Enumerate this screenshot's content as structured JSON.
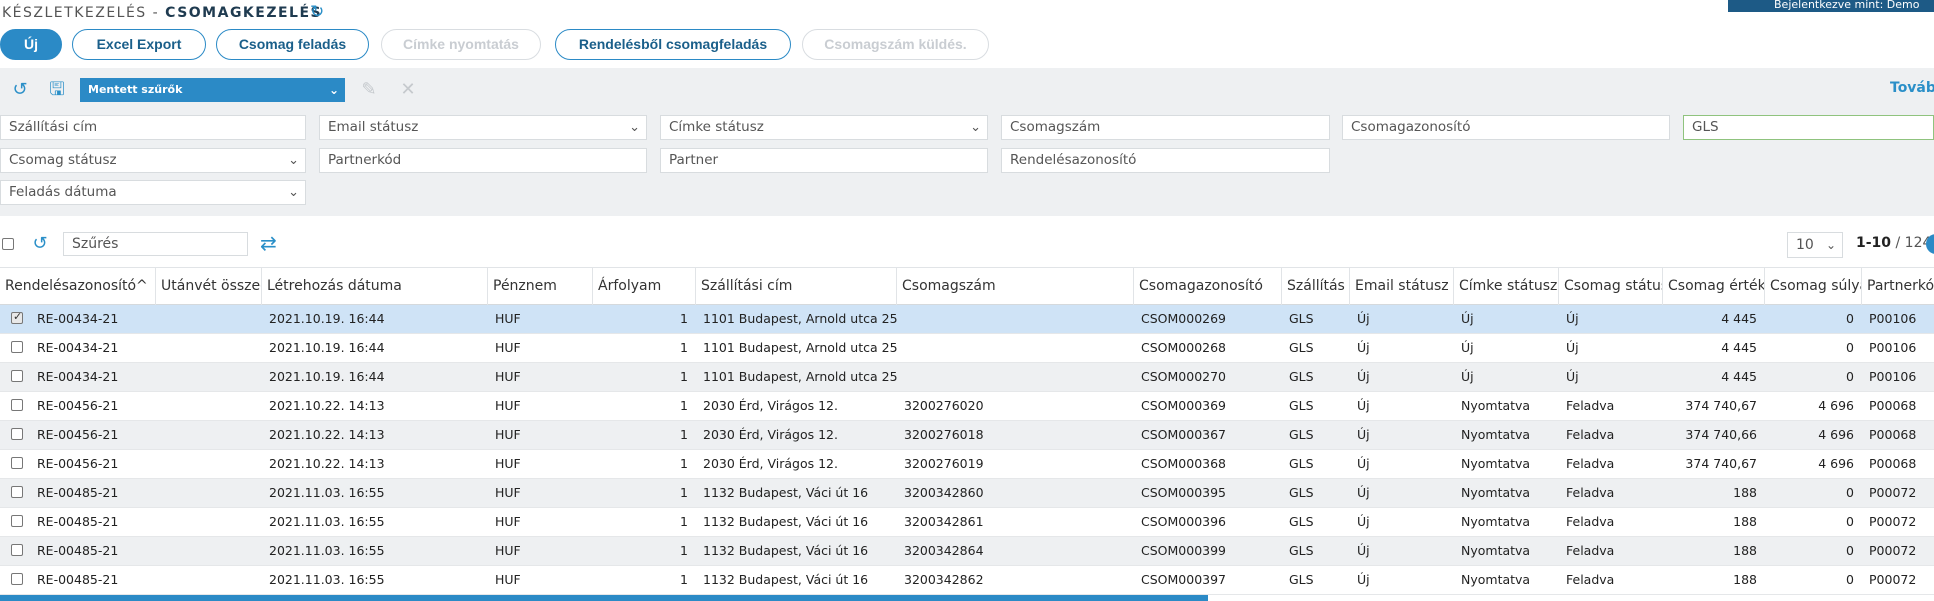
{
  "header": {
    "breadcrumb_parent": "KÉSZLETKEZELÉS",
    "breadcrumb_sep": " - ",
    "breadcrumb_current": "CSOMAGKEZELÉS",
    "login_text": "Bejelentkezve mint: Demo",
    "refresh_icon": "refresh-icon"
  },
  "actions": {
    "new": "Új",
    "excel_export": "Excel Export",
    "package_send": "Csomag feladás",
    "label_print": "Címke nyomtatás",
    "order_package_send": "Rendelésből csomagfeladás",
    "package_number_send": "Csomagszám küldés."
  },
  "filters": {
    "saved_filters": "Mentett szűrők",
    "more": "Tovább",
    "shipping_address": "Szállítási cím",
    "email_status": "Email státusz",
    "label_status": "Címke státusz",
    "package_number": "Csomagszám",
    "package_id": "Csomagazonosító",
    "carrier_value": "GLS",
    "package_status": "Csomag státusz",
    "partner_code": "Partnerkód",
    "partner": "Partner",
    "order_id": "Rendelésazonosító",
    "ship_date": "Feladás dátuma"
  },
  "table_toolbar": {
    "search_placeholder": "Szűrés",
    "page_size": "10",
    "page_range": "1-10",
    "page_total": " / 124"
  },
  "columns": [
    "Rendelésazonosító^",
    "Utánvét összeg",
    "Létrehozás dátuma",
    "Pénznem",
    "Árfolyam",
    "Szállítási cím",
    "Csomagszám",
    "Csomagazonosító",
    "Szállítás",
    "Email státusz",
    "Címke státusz",
    "Csomag státusz",
    "Csomag érték",
    "Csomag súlya",
    "Partnerkód"
  ],
  "rows": [
    {
      "checked": true,
      "order": "RE-00434-21",
      "cod": "",
      "created": "2021.10.19. 16:44",
      "currency": "HUF",
      "rate": "1",
      "address": "1101 Budapest, Arnold utca 25",
      "pkg_no": "",
      "pkg_id": "CSOM000269",
      "carrier": "GLS",
      "email": "Új",
      "label": "Új",
      "pkg_status": "Új",
      "value": "4 445",
      "weight": "0",
      "partner": "P00106"
    },
    {
      "checked": false,
      "order": "RE-00434-21",
      "cod": "",
      "created": "2021.10.19. 16:44",
      "currency": "HUF",
      "rate": "1",
      "address": "1101 Budapest, Arnold utca 25",
      "pkg_no": "",
      "pkg_id": "CSOM000268",
      "carrier": "GLS",
      "email": "Új",
      "label": "Új",
      "pkg_status": "Új",
      "value": "4 445",
      "weight": "0",
      "partner": "P00106"
    },
    {
      "checked": false,
      "order": "RE-00434-21",
      "cod": "",
      "created": "2021.10.19. 16:44",
      "currency": "HUF",
      "rate": "1",
      "address": "1101 Budapest, Arnold utca 25",
      "pkg_no": "",
      "pkg_id": "CSOM000270",
      "carrier": "GLS",
      "email": "Új",
      "label": "Új",
      "pkg_status": "Új",
      "value": "4 445",
      "weight": "0",
      "partner": "P00106"
    },
    {
      "checked": false,
      "order": "RE-00456-21",
      "cod": "",
      "created": "2021.10.22. 14:13",
      "currency": "HUF",
      "rate": "1",
      "address": "2030 Érd, Virágos 12.",
      "pkg_no": "3200276020",
      "pkg_id": "CSOM000369",
      "carrier": "GLS",
      "email": "Új",
      "label": "Nyomtatva",
      "pkg_status": "Feladva",
      "value": "374 740,67",
      "weight": "4 696",
      "partner": "P00068"
    },
    {
      "checked": false,
      "order": "RE-00456-21",
      "cod": "",
      "created": "2021.10.22. 14:13",
      "currency": "HUF",
      "rate": "1",
      "address": "2030 Érd, Virágos 12.",
      "pkg_no": "3200276018",
      "pkg_id": "CSOM000367",
      "carrier": "GLS",
      "email": "Új",
      "label": "Nyomtatva",
      "pkg_status": "Feladva",
      "value": "374 740,66",
      "weight": "4 696",
      "partner": "P00068"
    },
    {
      "checked": false,
      "order": "RE-00456-21",
      "cod": "",
      "created": "2021.10.22. 14:13",
      "currency": "HUF",
      "rate": "1",
      "address": "2030 Érd, Virágos 12.",
      "pkg_no": "3200276019",
      "pkg_id": "CSOM000368",
      "carrier": "GLS",
      "email": "Új",
      "label": "Nyomtatva",
      "pkg_status": "Feladva",
      "value": "374 740,67",
      "weight": "4 696",
      "partner": "P00068"
    },
    {
      "checked": false,
      "order": "RE-00485-21",
      "cod": "",
      "created": "2021.11.03. 16:55",
      "currency": "HUF",
      "rate": "1",
      "address": "1132 Budapest, Váci út 16",
      "pkg_no": "3200342860",
      "pkg_id": "CSOM000395",
      "carrier": "GLS",
      "email": "Új",
      "label": "Nyomtatva",
      "pkg_status": "Feladva",
      "value": "188",
      "weight": "0",
      "partner": "P00072"
    },
    {
      "checked": false,
      "order": "RE-00485-21",
      "cod": "",
      "created": "2021.11.03. 16:55",
      "currency": "HUF",
      "rate": "1",
      "address": "1132 Budapest, Váci út 16",
      "pkg_no": "3200342861",
      "pkg_id": "CSOM000396",
      "carrier": "GLS",
      "email": "Új",
      "label": "Nyomtatva",
      "pkg_status": "Feladva",
      "value": "188",
      "weight": "0",
      "partner": "P00072"
    },
    {
      "checked": false,
      "order": "RE-00485-21",
      "cod": "",
      "created": "2021.11.03. 16:55",
      "currency": "HUF",
      "rate": "1",
      "address": "1132 Budapest, Váci út 16",
      "pkg_no": "3200342864",
      "pkg_id": "CSOM000399",
      "carrier": "GLS",
      "email": "Új",
      "label": "Nyomtatva",
      "pkg_status": "Feladva",
      "value": "188",
      "weight": "0",
      "partner": "P00072"
    },
    {
      "checked": false,
      "order": "RE-00485-21",
      "cod": "",
      "created": "2021.11.03. 16:55",
      "currency": "HUF",
      "rate": "1",
      "address": "1132 Budapest, Váci út 16",
      "pkg_no": "3200342862",
      "pkg_id": "CSOM000397",
      "carrier": "GLS",
      "email": "Új",
      "label": "Nyomtatva",
      "pkg_status": "Feladva",
      "value": "188",
      "weight": "0",
      "partner": "P00072"
    }
  ],
  "colors": {
    "accent": "#2b8ac6",
    "selected_row": "#cfe3f6",
    "panel": "#eef0f2"
  }
}
